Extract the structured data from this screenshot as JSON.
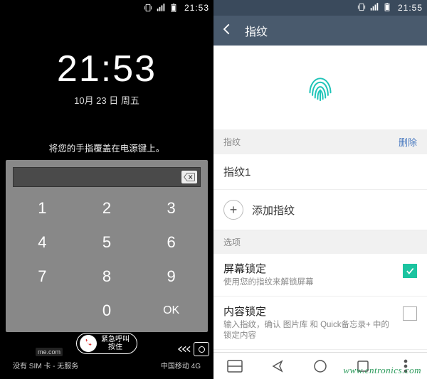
{
  "left": {
    "statusbar": {
      "time": "21:53"
    },
    "clock": {
      "time": "21:53",
      "date": "10月 23 日 周五"
    },
    "hint": "将您的手指覆盖在电源键上。",
    "keys": {
      "k1": "1",
      "k2": "2",
      "k3": "3",
      "k4": "4",
      "k5": "5",
      "k6": "6",
      "k7": "7",
      "k8": "8",
      "k9": "9",
      "k0": "0",
      "ok": "OK"
    },
    "emergency": {
      "line1": "紧急呼叫",
      "line2": "按住"
    },
    "me_com": "me.com",
    "carrier": {
      "left": "没有 SIM 卡 - 无服务",
      "right": "中国移动 4G"
    }
  },
  "right": {
    "statusbar": {
      "time": "21:55"
    },
    "appbar": {
      "title": "指纹"
    },
    "sec_fp": {
      "label": "指纹",
      "delete": "删除"
    },
    "fp1": "指纹1",
    "add": "添加指纹",
    "sec_opt": "选项",
    "opt_lock": {
      "title": "屏幕锁定",
      "sub": "使用您的指纹来解锁屏幕"
    },
    "opt_content": {
      "title": "内容锁定",
      "sub": "输入指纹，确认 图片库 和 Quick备忘录+ 中的锁定内容"
    }
  },
  "watermark": "www.cntronics.com"
}
